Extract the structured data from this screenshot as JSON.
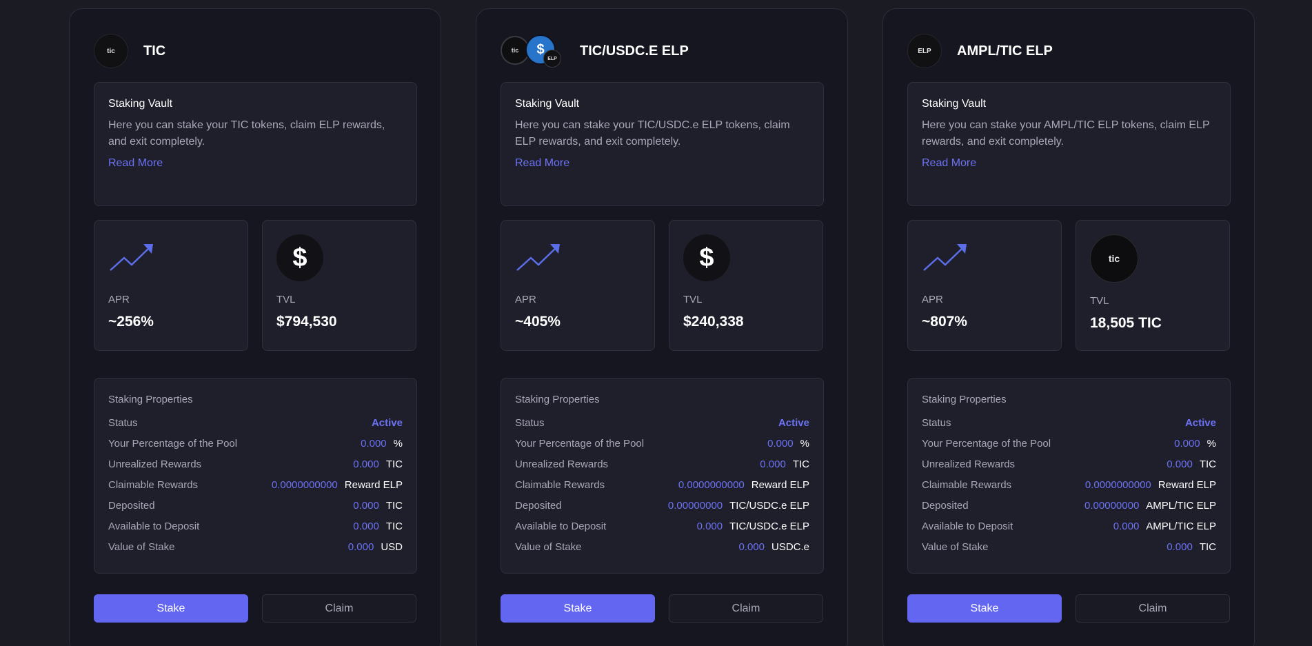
{
  "colors": {
    "accent": "#6366f1",
    "accent_text": "#6c72f4",
    "background": "#1b1b24",
    "card": "#161620"
  },
  "cards": [
    {
      "title": "TIC",
      "icon_text": "tic",
      "vault_title": "Staking Vault",
      "vault_desc": "Here you can stake your TIC tokens, claim ELP rewards, and exit completely.",
      "read_more": "Read More",
      "apr_label": "APR",
      "apr_value": "~256%",
      "tvl_label": "TVL",
      "tvl_value": "$794,530",
      "tvl_icon": "dollar-icon",
      "props_title": "Staking Properties",
      "status_label": "Status",
      "status_value": "Active",
      "rows": [
        {
          "label": "Your Percentage of the Pool",
          "value": "0.000",
          "unit": "%"
        },
        {
          "label": "Unrealized Rewards",
          "value": "0.000",
          "unit": "TIC"
        },
        {
          "label": "Claimable Rewards",
          "value": "0.0000000000",
          "unit": "Reward ELP"
        },
        {
          "label": "Deposited",
          "value": "0.000",
          "unit": "TIC"
        },
        {
          "label": "Available to Deposit",
          "value": "0.000",
          "unit": "TIC"
        },
        {
          "label": "Value of Stake",
          "value": "0.000",
          "unit": "USD"
        }
      ],
      "stake_label": "Stake",
      "claim_label": "Claim"
    },
    {
      "title": "TIC/USDC.E ELP",
      "icon_text": "tic",
      "icon_text_2": "$",
      "icon_text_3": "ELP",
      "vault_title": "Staking Vault",
      "vault_desc": "Here you can stake your TIC/USDC.e ELP tokens, claim ELP rewards, and exit completely.",
      "read_more": "Read More",
      "apr_label": "APR",
      "apr_value": "~405%",
      "tvl_label": "TVL",
      "tvl_value": "$240,338",
      "tvl_icon": "dollar-icon",
      "props_title": "Staking Properties",
      "status_label": "Status",
      "status_value": "Active",
      "rows": [
        {
          "label": "Your Percentage of the Pool",
          "value": "0.000",
          "unit": "%"
        },
        {
          "label": "Unrealized Rewards",
          "value": "0.000",
          "unit": "TIC"
        },
        {
          "label": "Claimable Rewards",
          "value": "0.0000000000",
          "unit": "Reward ELP"
        },
        {
          "label": "Deposited",
          "value": "0.00000000",
          "unit": "TIC/USDC.e ELP"
        },
        {
          "label": "Available to Deposit",
          "value": "0.000",
          "unit": "TIC/USDC.e ELP"
        },
        {
          "label": "Value of Stake",
          "value": "0.000",
          "unit": "USDC.e"
        }
      ],
      "stake_label": "Stake",
      "claim_label": "Claim"
    },
    {
      "title": "AMPL/TIC ELP",
      "icon_text": "ELP",
      "vault_title": "Staking Vault",
      "vault_desc": "Here you can stake your AMPL/TIC ELP tokens, claim ELP rewards, and exit completely.",
      "read_more": "Read More",
      "apr_label": "APR",
      "apr_value": "~807%",
      "tvl_label": "TVL",
      "tvl_value": "18,505 TIC",
      "tvl_icon": "tic-icon",
      "tvl_icon_text": "tic",
      "props_title": "Staking Properties",
      "status_label": "Status",
      "status_value": "Active",
      "rows": [
        {
          "label": "Your Percentage of the Pool",
          "value": "0.000",
          "unit": "%"
        },
        {
          "label": "Unrealized Rewards",
          "value": "0.000",
          "unit": "TIC"
        },
        {
          "label": "Claimable Rewards",
          "value": "0.0000000000",
          "unit": "Reward ELP"
        },
        {
          "label": "Deposited",
          "value": "0.00000000",
          "unit": "AMPL/TIC ELP"
        },
        {
          "label": "Available to Deposit",
          "value": "0.000",
          "unit": "AMPL/TIC ELP"
        },
        {
          "label": "Value of Stake",
          "value": "0.000",
          "unit": "TIC"
        }
      ],
      "stake_label": "Stake",
      "claim_label": "Claim"
    }
  ]
}
